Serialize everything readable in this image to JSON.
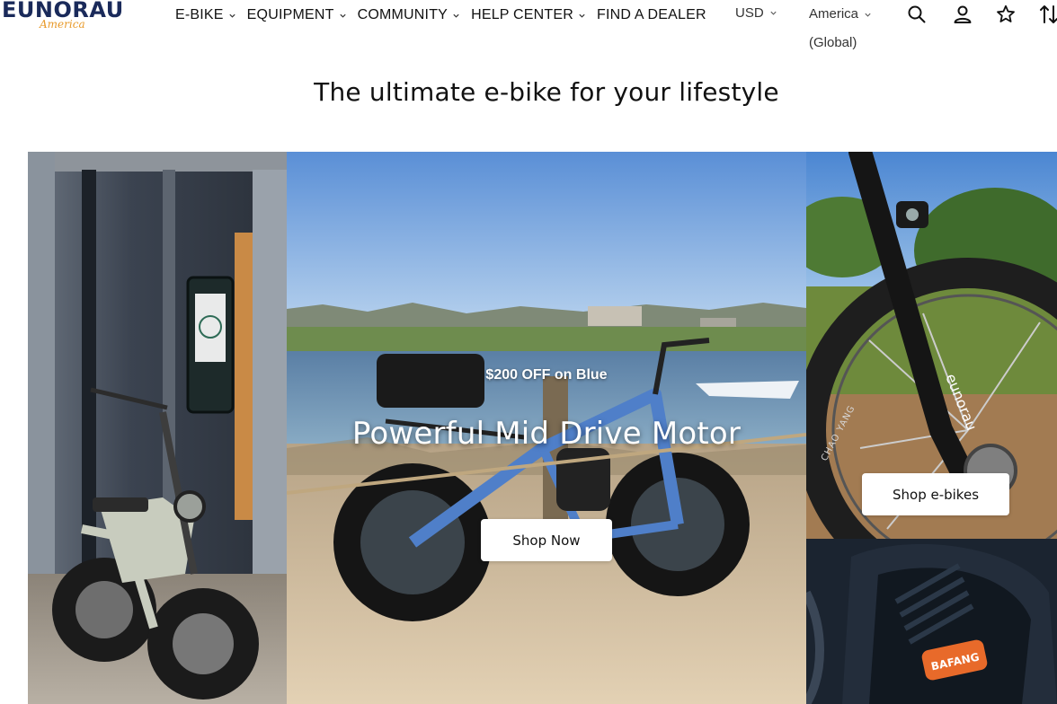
{
  "brand": {
    "name": "EUNORAU",
    "sub": "America"
  },
  "nav": [
    {
      "label": "E-BIKE",
      "has_dropdown": true
    },
    {
      "label": "EQUIPMENT",
      "has_dropdown": true
    },
    {
      "label": "COMMUNITY",
      "has_dropdown": true
    },
    {
      "label": "HELP CENTER",
      "has_dropdown": true
    },
    {
      "label": "FIND A DEALER",
      "has_dropdown": false
    }
  ],
  "currency": {
    "label": "USD"
  },
  "region": {
    "line1": "America",
    "line2": "(Global)"
  },
  "header_icons": [
    "search-icon",
    "account-icon",
    "star-icon",
    "sort-icon"
  ],
  "headline": "The ultimate e-bike for your lifestyle",
  "hero": {
    "promo": "$200 OFF on Blue",
    "title": "Powerful Mid Drive Motor",
    "cta": "Shop Now"
  },
  "side_panel": {
    "cta": "Shop e-bikes",
    "tire_text": "CHAO YANG",
    "fork_text": "eunorau",
    "motor_badge": "BAFANG"
  },
  "colors": {
    "text": "#111111",
    "sky": "#6f9fd8",
    "sand": "#cdb89a",
    "bike_blue": "#4f7fc9",
    "logo_navy": "#1a2a5a",
    "logo_orange": "#e89a2a",
    "badge_orange": "#e86a2a"
  }
}
